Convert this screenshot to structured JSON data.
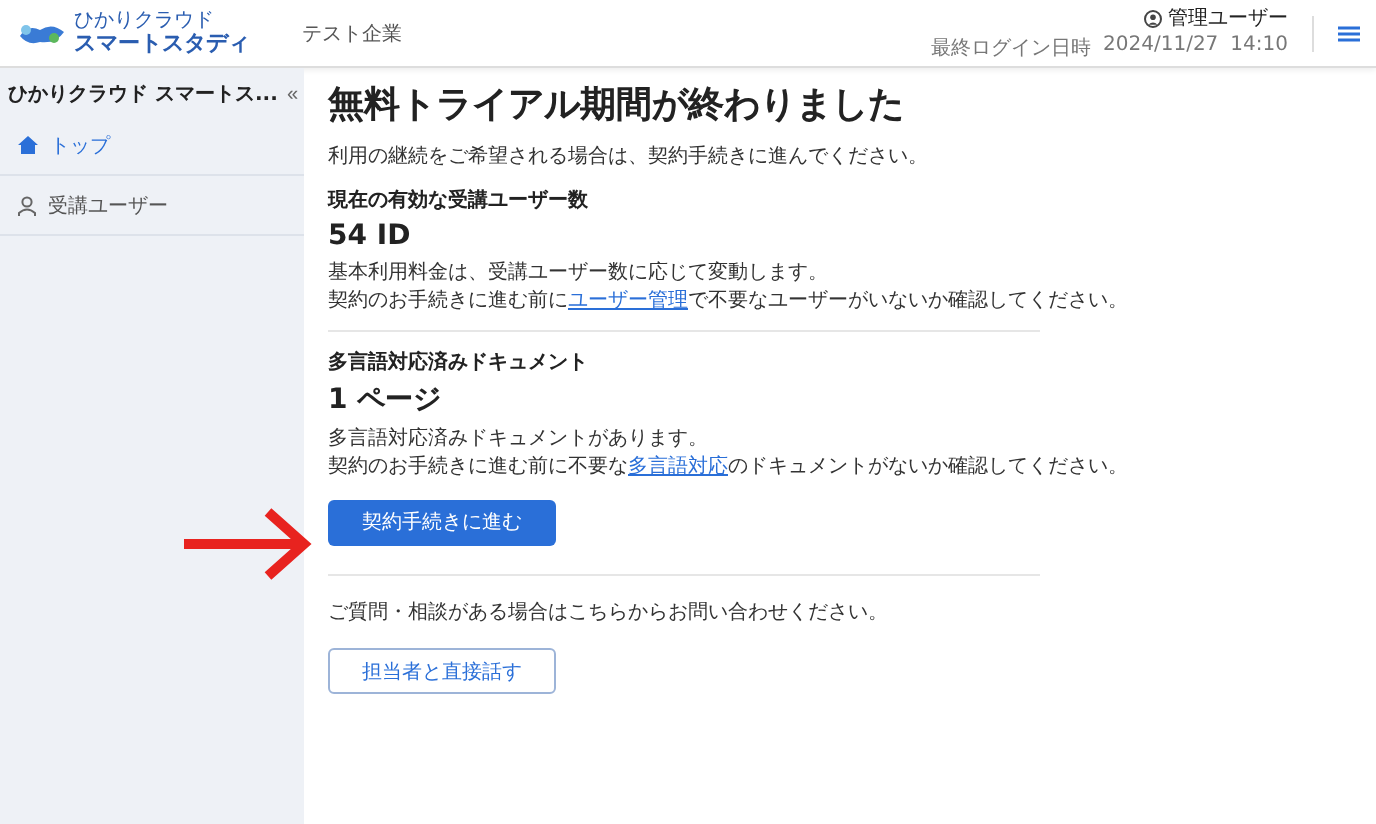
{
  "header": {
    "logo_small": "ひかりクラウド",
    "logo_large": "スマートスタディ",
    "company": "テスト企業",
    "user": "管理ユーザー",
    "last_login_label": "最終ログイン日時",
    "last_login_date": "2024/11/27",
    "last_login_time": "14:10"
  },
  "sidebar": {
    "title": "ひかりクラウド スマートス...",
    "collapse": "«",
    "items": [
      {
        "label": "トップ",
        "kind": "home",
        "selected": true
      },
      {
        "label": "受講ユーザー",
        "kind": "user",
        "selected": false
      }
    ]
  },
  "main": {
    "title": "無料トライアル期間が終わりました",
    "intro": "利用の継続をご希望される場合は、契約手続きに進んでください。",
    "sections": [
      {
        "label": "現在の有効な受講ユーザー数",
        "value": "54 ID",
        "lines": [
          {
            "text": "基本利用料金は、受講ユーザー数に応じて変動します。"
          },
          {
            "before": "契約のお手続きに進む前に",
            "link": "ユーザー管理",
            "after": "で不要なユーザーがいないか確認してください。"
          }
        ]
      },
      {
        "label": "多言語対応済みドキュメント",
        "value": "1 ページ",
        "lines": [
          {
            "text": "多言語対応済みドキュメントがあります。"
          },
          {
            "before": "契約のお手続きに進む前に不要な",
            "link": "多言語対応",
            "after": "のドキュメントがないか確認してください。"
          }
        ]
      }
    ],
    "primary_button": "契約手続きに進む",
    "contact_text": "ご質問・相談がある場合はこちらからお問い合わせください。",
    "contact_button": "担当者と直接話す"
  }
}
